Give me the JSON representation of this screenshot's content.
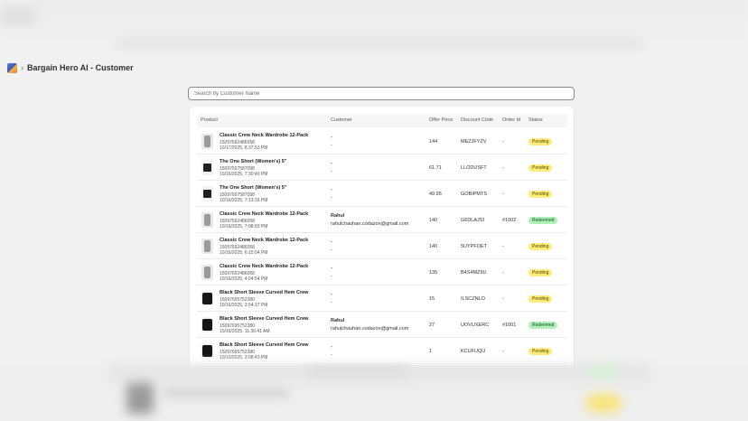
{
  "header": {
    "app_title": "Bargain Hero AI - Customer",
    "chevron": "›"
  },
  "search": {
    "placeholder": "Search by Customer Name"
  },
  "table": {
    "columns": {
      "product": "Product",
      "customer": "Customer",
      "offer_price": "Offer Price",
      "discount_code": "Discount Code",
      "order_id": "Order Id",
      "status": "Status"
    },
    "rows": [
      {
        "thumb": "shirt",
        "name": "Classic Crew Neck Wardrobe 12-Pack",
        "id": "15097692486058",
        "date": "10/17/2025, 8:37:53 PM",
        "customer_name": "-",
        "customer_email": "-",
        "price": "144",
        "code": "MEZJFYZV",
        "order": "-",
        "status": "Pending"
      },
      {
        "thumb": "short",
        "name": "The One Short (Women's) 5\"",
        "id": "15097697587098",
        "date": "10/16/2025, 7:30:40 PM",
        "customer_name": "-",
        "customer_email": "-",
        "price": "61.71",
        "code": "LLODUSFT",
        "order": "-",
        "status": "Pending"
      },
      {
        "thumb": "short",
        "name": "The One Short (Women's) 5\"",
        "id": "15097697587098",
        "date": "10/16/2025, 7:13:16 PM",
        "customer_name": "-",
        "customer_email": "-",
        "price": "49.95",
        "code": "GOBIPMTS",
        "order": "-",
        "status": "Pending"
      },
      {
        "thumb": "shirt",
        "name": "Classic Crew Neck Wardrobe 12-Pack",
        "id": "15097692486058",
        "date": "10/16/2025, 7:08:03 PM",
        "customer_name": "Rahul",
        "customer_email": "rahulchauhan.codazon@gmail.com",
        "price": "140",
        "code": "G6DLAJSI",
        "order": "#1002",
        "status": "Redeemed"
      },
      {
        "thumb": "shirt",
        "name": "Classic Crew Neck Wardrobe 12-Pack",
        "id": "15097692486058",
        "date": "10/16/2025, 6:15:04 PM",
        "customer_name": "-",
        "customer_email": "-",
        "price": "140",
        "code": "5UYPFOET",
        "order": "-",
        "status": "Pending"
      },
      {
        "thumb": "shirt",
        "name": "Classic Crew Neck Wardrobe 12-Pack",
        "id": "15097692486058",
        "date": "10/16/2025, 4:04:54 PM",
        "customer_name": "-",
        "customer_email": "-",
        "price": "135",
        "code": "B4S4MZ9U",
        "order": "-",
        "status": "Pending"
      },
      {
        "thumb": "tee",
        "name": "Black Short Sleeve Curved Hem Crew",
        "id": "15097695752380",
        "date": "10/16/2025, 3:54:37 PM",
        "customer_name": "-",
        "customer_email": "-",
        "price": "15",
        "code": "ILSCZNLO",
        "order": "-",
        "status": "Pending"
      },
      {
        "thumb": "tee",
        "name": "Black Short Sleeve Curved Hem Crew",
        "id": "15097695752380",
        "date": "10/16/2025, 11:30:41 AM",
        "customer_name": "Rahul",
        "customer_email": "rahulchauhan.codazon@gmail.com",
        "price": "27",
        "code": "UOVUXERC",
        "order": "#1001",
        "status": "Redeemed"
      },
      {
        "thumb": "tee",
        "name": "Black Short Sleeve Curved Hem Crew",
        "id": "15097695752380",
        "date": "10/10/2025, 3:08:43 PM",
        "customer_name": "-",
        "customer_email": "-",
        "price": "1",
        "code": "KCUFUQU",
        "order": "-",
        "status": "Pending"
      }
    ]
  },
  "colors": {
    "pending_bg": "#ffeb78",
    "redeemed_bg": "#aff0b5",
    "page_bg": "#f1f1f1"
  }
}
